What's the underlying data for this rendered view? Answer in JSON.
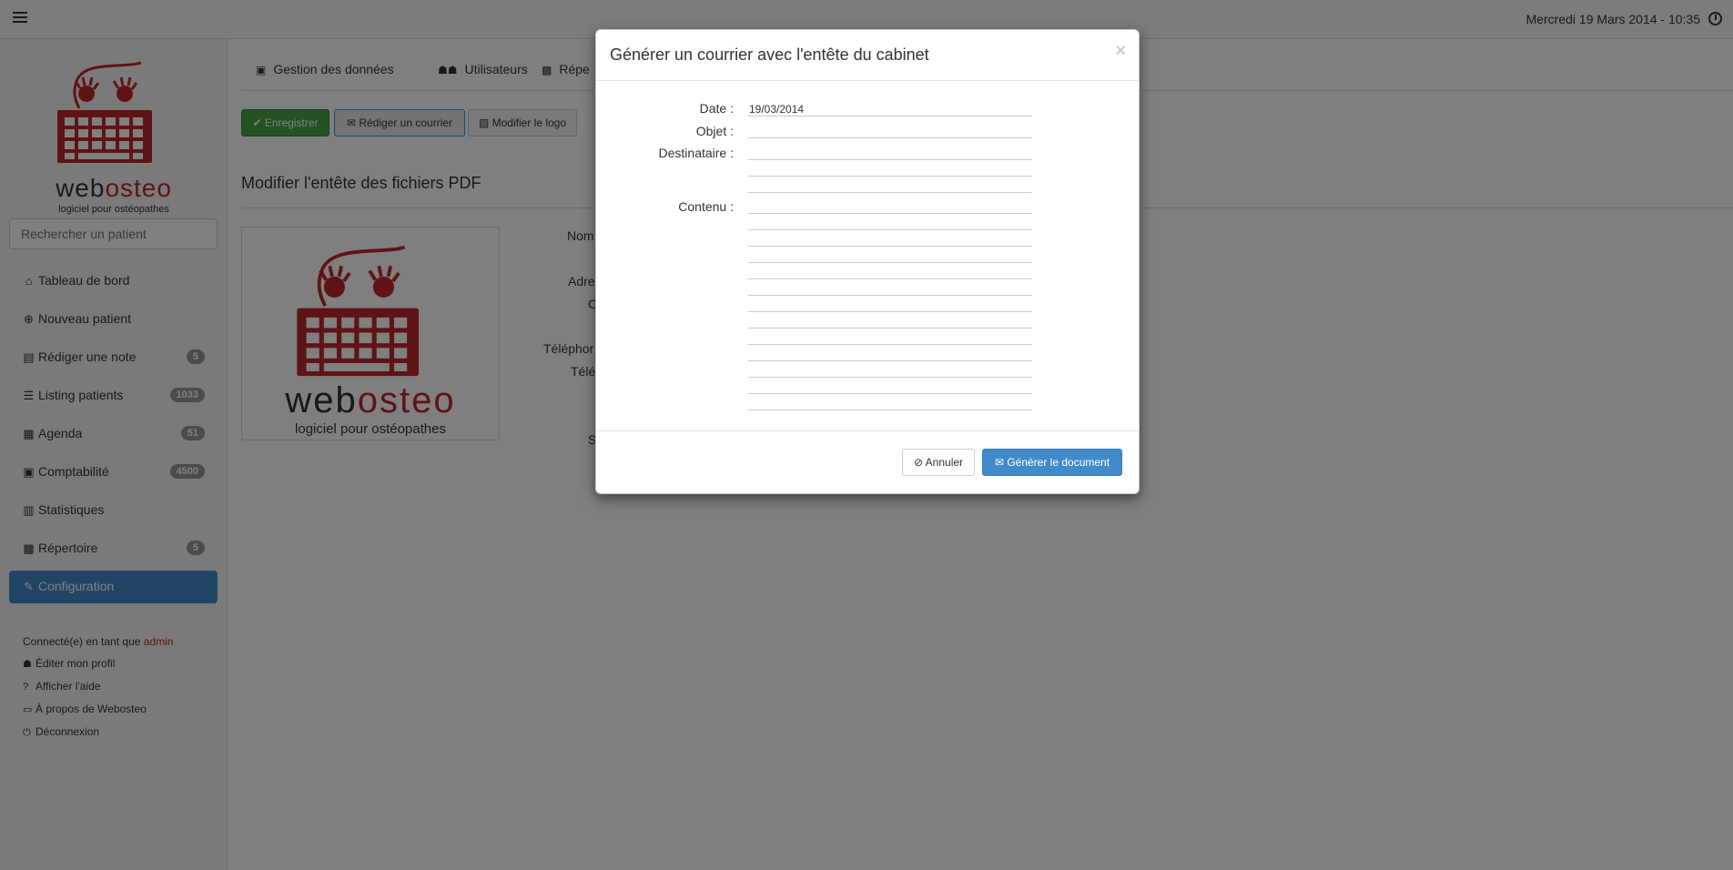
{
  "topbar": {
    "datetime": "Mercredi 19 Mars 2014 - 10:35"
  },
  "sidebar": {
    "logo_word_a": "web",
    "logo_word_b": "osteo",
    "logo_tagline": "logiciel pour ostéopathes",
    "search_placeholder": "Rechercher un patient",
    "items": [
      {
        "label": "Tableau de bord",
        "icon": "home-icon",
        "badge": ""
      },
      {
        "label": "Nouveau patient",
        "icon": "plus-circle-icon",
        "badge": ""
      },
      {
        "label": "Rédiger une note",
        "icon": "note-icon",
        "badge": "5"
      },
      {
        "label": "Listing patients",
        "icon": "list-icon",
        "badge": "1033"
      },
      {
        "label": "Agenda",
        "icon": "calendar-icon",
        "badge": "51"
      },
      {
        "label": "Comptabilité",
        "icon": "calculator-icon",
        "badge": "4500"
      },
      {
        "label": "Statistiques",
        "icon": "bar-chart-icon",
        "badge": ""
      },
      {
        "label": "Répertoire",
        "icon": "address-book-icon",
        "badge": "5"
      },
      {
        "label": "Configuration",
        "icon": "wrench-icon",
        "badge": ""
      }
    ],
    "user": {
      "connected_prefix": "Connecté(e) en tant que",
      "username": "admin",
      "links": [
        {
          "label": "Éditer mon profil",
          "icon": "user-icon"
        },
        {
          "label": "Afficher l'aide",
          "icon": "help-icon"
        },
        {
          "label": "À propos de Webosteo",
          "icon": "info-icon"
        },
        {
          "label": "Déconnexion",
          "icon": "power-icon"
        }
      ]
    }
  },
  "main": {
    "tabs": [
      {
        "label": "Gestion des données",
        "icon": "save-icon"
      },
      {
        "label": "Utilisateurs",
        "icon": "users-icon"
      },
      {
        "label": "Répe",
        "icon": "address-book-icon"
      }
    ],
    "buttons": {
      "save": "Enregistrer",
      "write_letter": "Rédiger un courrier",
      "change_logo": "Modifier le logo"
    },
    "section_title": "Modifier l'entête des fichiers PDF",
    "logo_word_a": "web",
    "logo_word_b": "osteo",
    "logo_tagline": "logiciel pour ostéopathes",
    "field_labels": [
      "Nom",
      "Adre",
      "C",
      "Téléphor",
      "Télé",
      "S"
    ]
  },
  "modal": {
    "title": "Générer un courrier avec l'entête du cabinet",
    "close": "×",
    "fields": {
      "date_label": "Date :",
      "date_value": "19/03/2014",
      "object_label": "Objet :",
      "recipient_label": "Destinataire :",
      "content_label": "Contenu :"
    },
    "cancel_label": "Annuler",
    "generate_label": "Générer le document"
  },
  "colors": {
    "brand_red": "#c0272d",
    "primary": "#428bca",
    "success": "#47a447"
  }
}
